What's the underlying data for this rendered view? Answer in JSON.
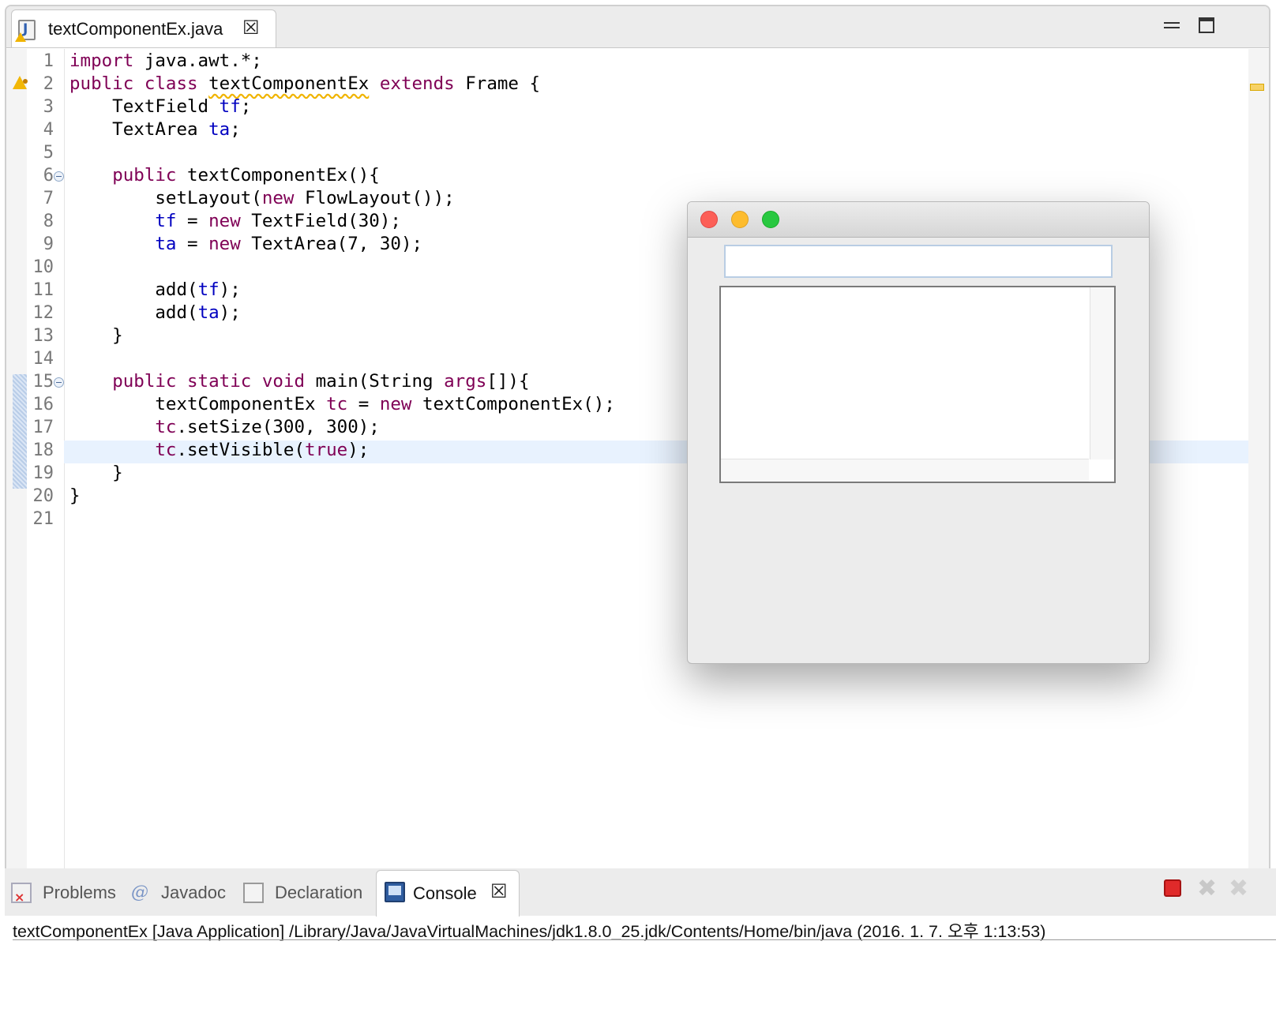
{
  "editor": {
    "tab_title": "textComponentEx.java",
    "tab_close": "☒",
    "line_numbers": [
      "1",
      "2",
      "3",
      "4",
      "5",
      "6",
      "7",
      "8",
      "9",
      "10",
      "11",
      "12",
      "13",
      "14",
      "15",
      "16",
      "17",
      "18",
      "19",
      "20",
      "21"
    ],
    "current_line": "18"
  },
  "awt_window": {
    "textfield_value": "",
    "textarea_value": ""
  },
  "console_view": {
    "tabs": [
      {
        "label": "Problems",
        "icon": "problems-icon"
      },
      {
        "label": "Javadoc",
        "icon": "javadoc-icon"
      },
      {
        "label": "Declaration",
        "icon": "declaration-icon"
      },
      {
        "label": "Console",
        "icon": "console-icon"
      }
    ],
    "active_tab": "Console",
    "close_glyph": "☒",
    "description": "textComponentEx [Java Application] /Library/Java/JavaVirtualMachines/jdk1.8.0_25.jdk/Contents/Home/bin/java (2016. 1. 7. 오후 1:13:53)"
  },
  "colors": {
    "keyword": "#7f0055",
    "field": "#0000c0",
    "current_line_highlight": "#e8f2fe",
    "warning": "#f0b400"
  }
}
